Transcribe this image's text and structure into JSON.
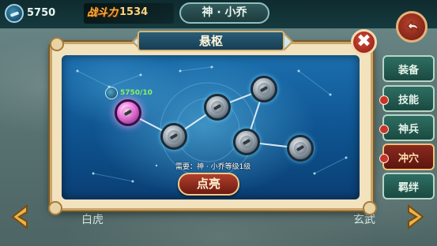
{
  "header": {
    "resource_value": "5750",
    "power_label": "战斗力",
    "power_value": "1534",
    "hero_title": "神 · 小乔"
  },
  "side_tabs": [
    {
      "label": "装备",
      "active": false
    },
    {
      "label": "技能",
      "active": false
    },
    {
      "label": "神兵",
      "active": false
    },
    {
      "label": "冲穴",
      "active": true
    },
    {
      "label": "羁绊",
      "active": false
    }
  ],
  "nav": {
    "left_label": "白虎",
    "right_label": "玄武"
  },
  "modal": {
    "title": "悬枢",
    "close_symbol": "✖",
    "node_cost": "5750/10",
    "requirement": "需要：神 · 小乔等级1级",
    "action_label": "点亮"
  },
  "constellation": {
    "nodes": [
      {
        "id": "n1",
        "lit": true
      },
      {
        "id": "n2",
        "lit": false
      },
      {
        "id": "n3",
        "lit": false
      },
      {
        "id": "n4",
        "lit": false
      },
      {
        "id": "n5",
        "lit": false
      },
      {
        "id": "n6",
        "lit": false
      }
    ]
  },
  "colors": {
    "accent_red": "#8a2a1e",
    "panel_blue": "#0f5592",
    "frame_gold": "#c8a56a",
    "cost_green": "#8cf06a"
  }
}
